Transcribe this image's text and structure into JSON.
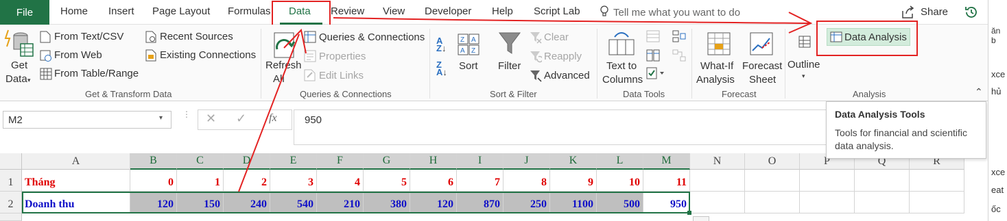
{
  "tabs": {
    "file": "File",
    "home": "Home",
    "insert": "Insert",
    "page_layout": "Page Layout",
    "formulas": "Formulas",
    "data": "Data",
    "review": "Review",
    "view": "View",
    "developer": "Developer",
    "help": "Help",
    "script_lab": "Script Lab",
    "tell_me": "Tell me what you want to do",
    "share": "Share"
  },
  "ribbon": {
    "get_data": "Get",
    "get_data2": "Data",
    "from_text": "From Text/CSV",
    "from_web": "From Web",
    "from_table": "From Table/Range",
    "recent_sources": "Recent Sources",
    "existing_connections": "Existing Connections",
    "group_get": "Get & Transform Data",
    "refresh": "Refresh",
    "refresh2": "All",
    "queries_connections": "Queries & Connections",
    "properties": "Properties",
    "edit_links": "Edit Links",
    "group_queries": "Queries & Connections",
    "sort": "Sort",
    "filter": "Filter",
    "clear": "Clear",
    "reapply": "Reapply",
    "advanced": "Advanced",
    "group_sort": "Sort & Filter",
    "text_to_columns": "Text to",
    "text_to_columns2": "Columns",
    "group_tools": "Data Tools",
    "what_if": "What-If",
    "what_if2": "Analysis",
    "forecast_sheet": "Forecast",
    "forecast_sheet2": "Sheet",
    "group_forecast": "Forecast",
    "outline": "Outline",
    "data_analysis": "Data Analysis",
    "group_analysis": "Analysis"
  },
  "formula_bar": {
    "name_box": "M2",
    "fx": "fx",
    "value": "950"
  },
  "tooltip": {
    "title": "Data Analysis Tools",
    "body1": "Tools for financial and scientific",
    "body2": "data analysis."
  },
  "columns": [
    "A",
    "B",
    "C",
    "D",
    "E",
    "F",
    "G",
    "H",
    "I",
    "J",
    "K",
    "L",
    "M",
    "N",
    "O",
    "P",
    "Q",
    "R"
  ],
  "rows": [
    {
      "num": "1",
      "label": "Tháng",
      "values": [
        "0",
        "1",
        "2",
        "3",
        "4",
        "5",
        "6",
        "7",
        "8",
        "9",
        "10",
        "11"
      ]
    },
    {
      "num": "2",
      "label": "Doanh thu",
      "values": [
        "120",
        "150",
        "240",
        "540",
        "210",
        "380",
        "120",
        "870",
        "250",
        "1100",
        "500",
        "950"
      ]
    }
  ],
  "side_panel": [
    "ăn b",
    "xce",
    "hủ",
    "xce",
    "eat",
    "ốc"
  ],
  "accent_color": "#217346",
  "annotation_color": "#e32222"
}
